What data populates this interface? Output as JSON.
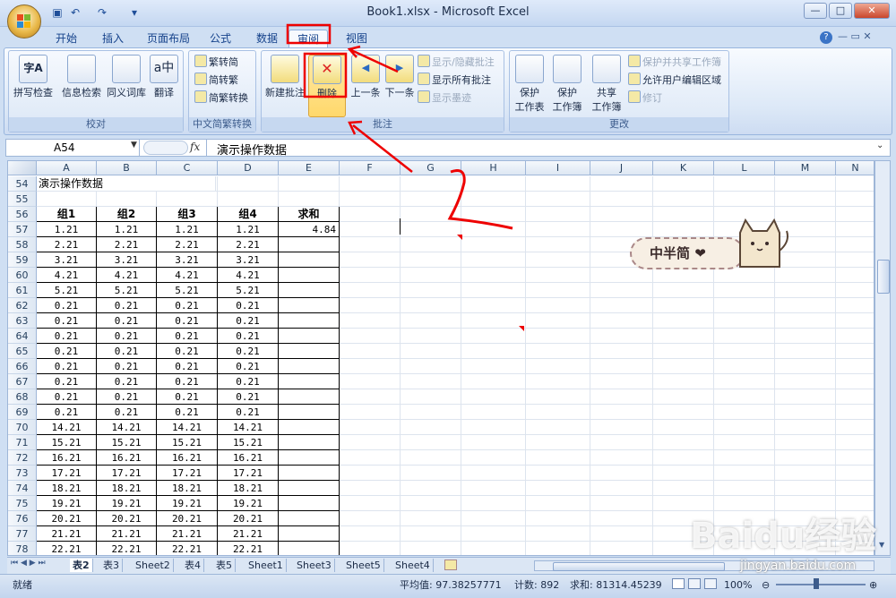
{
  "window": {
    "title": "Book1.xlsx - Microsoft Excel"
  },
  "quick_access": {
    "icons": [
      "save-icon",
      "undo-icon",
      "redo-icon",
      "customize-icon"
    ]
  },
  "tabs": [
    "开始",
    "插入",
    "页面布局",
    "公式",
    "数据",
    "审阅",
    "视图"
  ],
  "active_tab": "审阅",
  "ribbon": {
    "proofing": {
      "label": "校对",
      "buttons": [
        "拼写检查",
        "信息检索",
        "同义词库",
        "翻译"
      ]
    },
    "chinese": {
      "label": "中文简繁转换",
      "buttons": [
        "繁转简",
        "简转繁",
        "简繁转换"
      ]
    },
    "comments": {
      "label": "批注",
      "new": "新建批注",
      "delete": "删除",
      "prev": "上一条",
      "next": "下一条",
      "show_hide": "显示/隐藏批注",
      "show_all": "显示所有批注",
      "show_ink": "显示墨迹"
    },
    "changes": {
      "label": "更改",
      "protect_sheet": [
        "保护",
        "工作表"
      ],
      "protect_book": [
        "保护",
        "工作簿"
      ],
      "share_book": [
        "共享",
        "工作簿"
      ],
      "protect_share": "保护并共享工作簿",
      "allow_edit": "允许用户编辑区域",
      "track": "修订"
    }
  },
  "formula_bar": {
    "name_box": "A54",
    "fx": "fx",
    "formula": "演示操作数据"
  },
  "columns": [
    "A",
    "B",
    "C",
    "D",
    "E",
    "F",
    "G",
    "H",
    "I",
    "J",
    "K",
    "L",
    "M",
    "N"
  ],
  "rows": [
    54,
    55,
    56,
    57,
    58,
    59,
    60,
    61,
    62,
    63,
    64,
    65,
    66,
    67,
    68,
    69,
    70,
    71,
    72,
    73,
    74,
    75,
    76,
    77,
    78
  ],
  "cells": {
    "title": "演示操作数据",
    "headers": [
      "组1",
      "组2",
      "组3",
      "组4",
      "求和"
    ],
    "values": [
      "1.21",
      "2.21",
      "3.21",
      "4.21",
      "5.21",
      "0.21",
      "0.21",
      "0.21",
      "0.21",
      "0.21",
      "0.21",
      "0.21",
      "0.21",
      "14.21",
      "15.21",
      "16.21",
      "17.21",
      "18.21",
      "19.21",
      "20.21",
      "21.21",
      "22.21"
    ],
    "sum_value": "4.84"
  },
  "sheet_tabs": [
    "表2",
    "表3",
    "Sheet2",
    "表4",
    "表5",
    "Sheet1",
    "Sheet3",
    "Sheet5",
    "Sheet4"
  ],
  "active_sheet": "表2",
  "status": {
    "ready": "就绪",
    "average": "平均值: 97.38257771",
    "count": "计数: 892",
    "sum": "求和: 81314.45239",
    "zoom": "100%"
  },
  "sticker_text": "中半简",
  "annotation_number": "2",
  "watermark": "Baidu经验",
  "watermark_url": "jingyan.baidu.com",
  "colors": {
    "accent": "#15428b",
    "annotation": "#e00000",
    "ribbon_bg": "#dce8f7",
    "highlight": "#ffd86b"
  }
}
